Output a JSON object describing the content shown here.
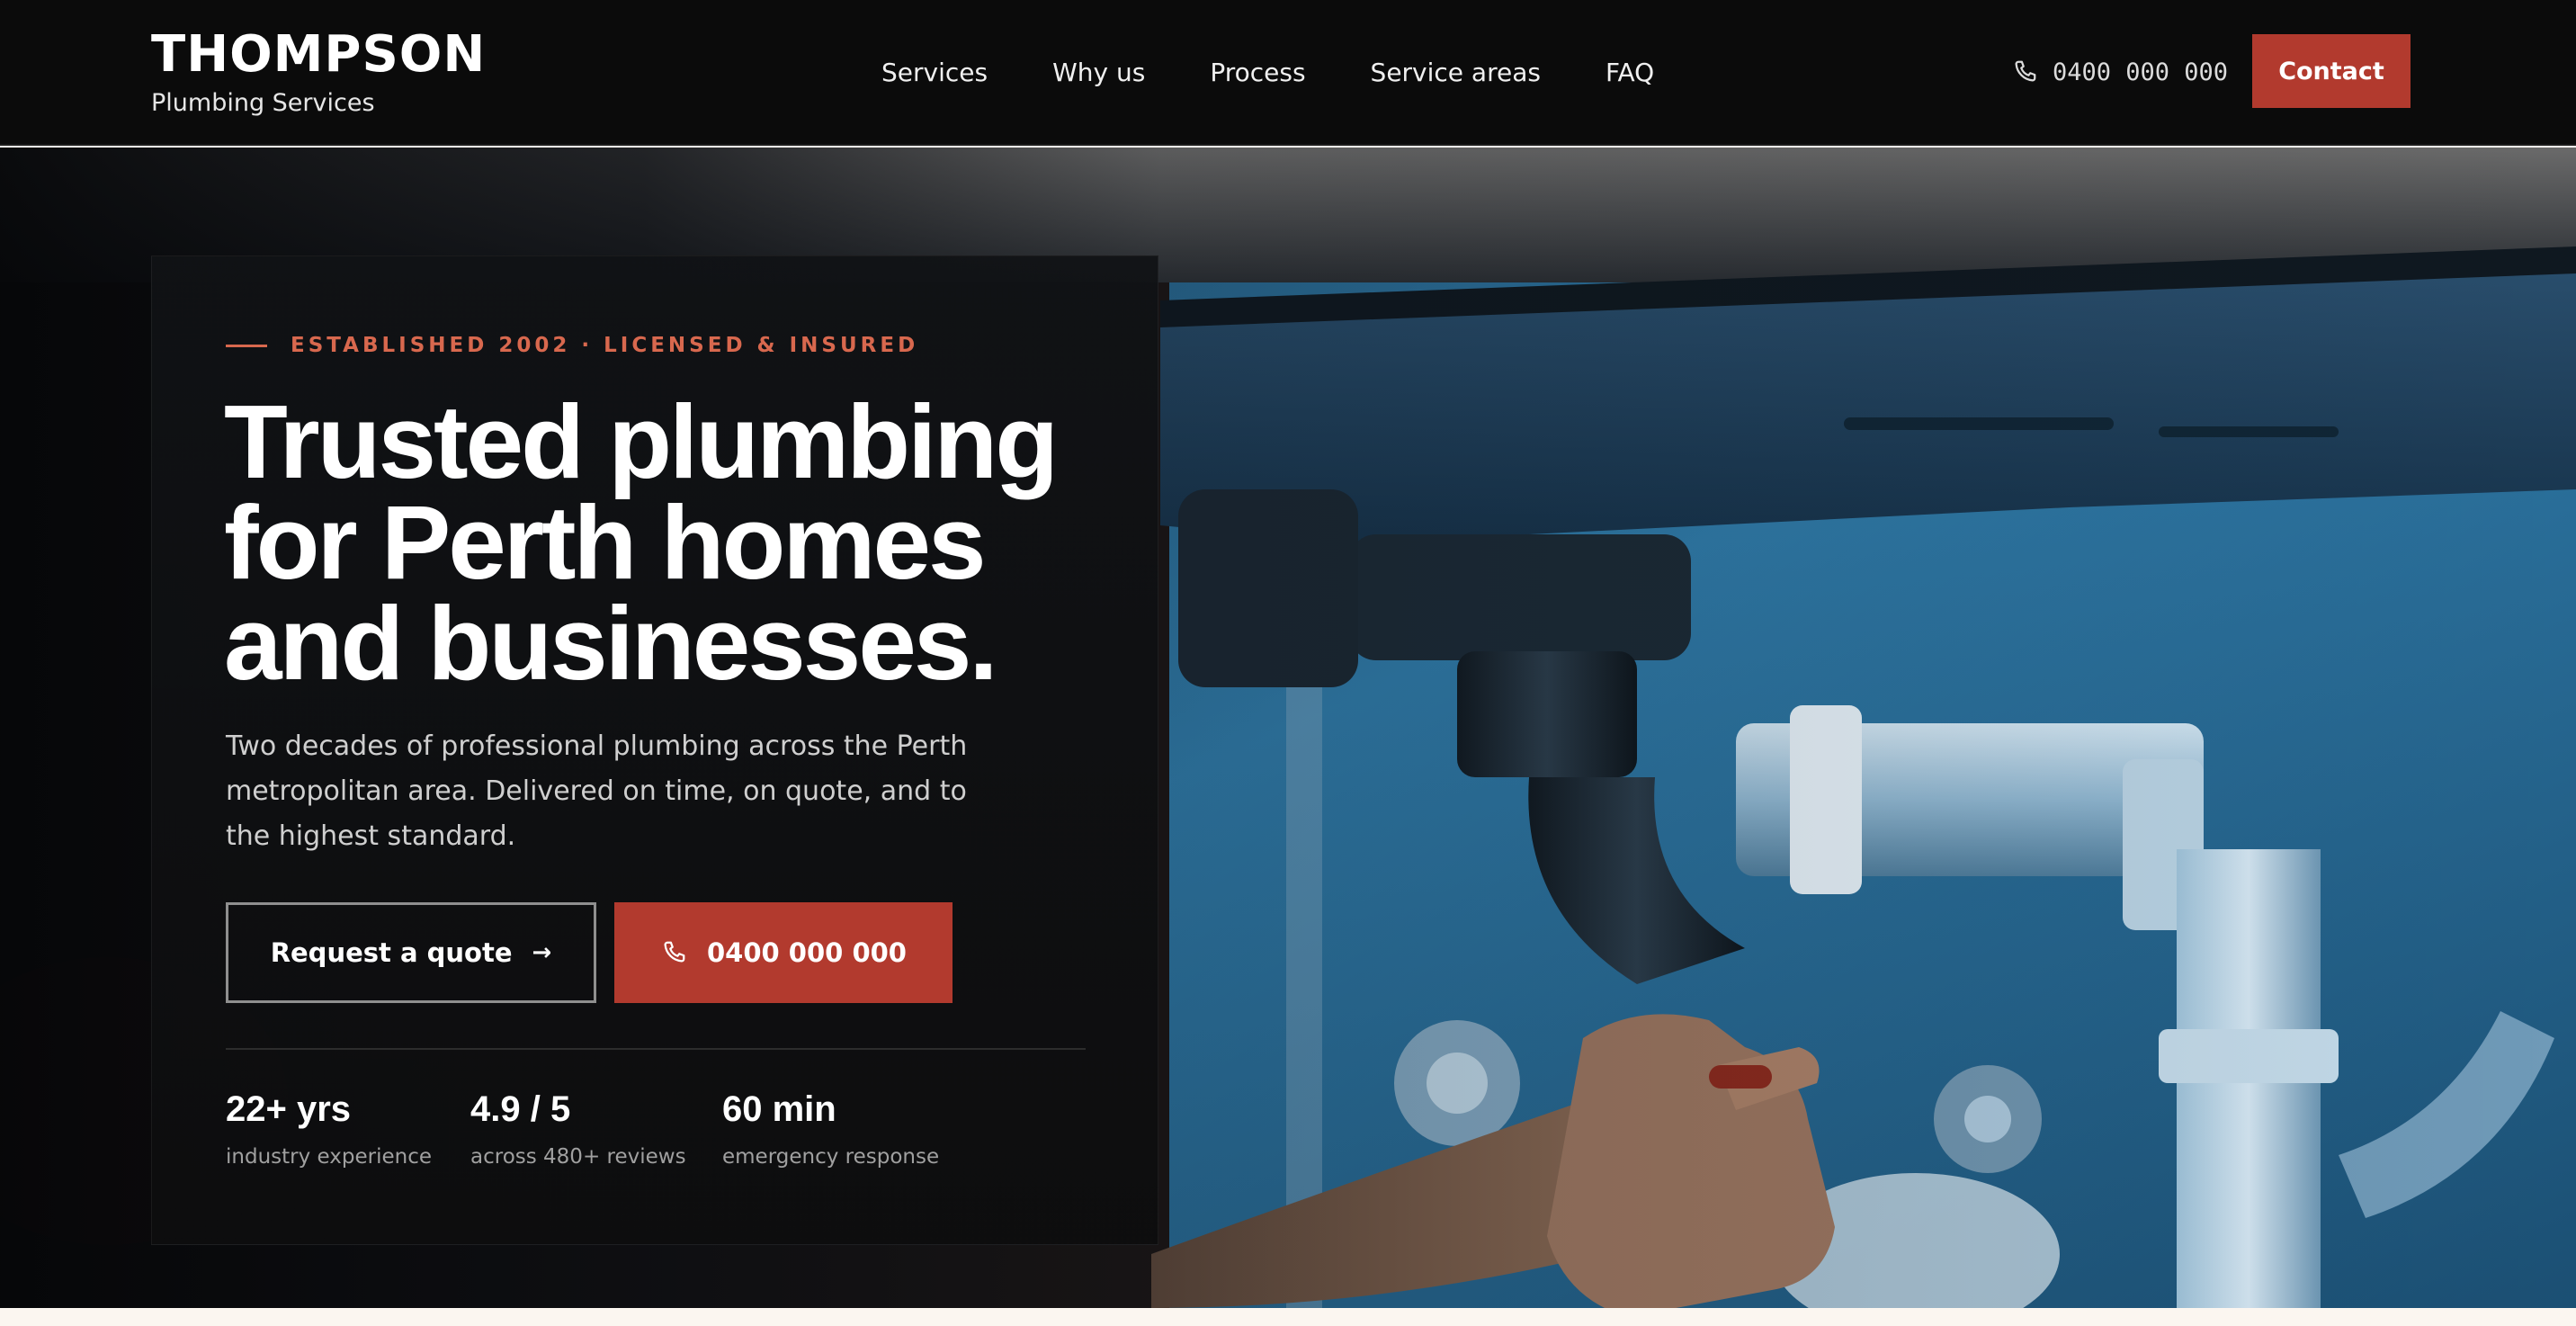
{
  "header": {
    "brand_name": "THOMPSON",
    "brand_sub": "Plumbing Services",
    "nav": [
      "Services",
      "Why us",
      "Process",
      "Service areas",
      "FAQ"
    ],
    "phone": "0400 000 000",
    "contact_label": "Contact"
  },
  "hero": {
    "eyebrow": "ESTABLISHED 2002 · LICENSED & INSURED",
    "headline_lines": [
      "Trusted plumbing",
      "for Perth homes",
      "and businesses."
    ],
    "lede": "Two decades of professional plumbing across the Perth metropolitan area. Delivered on time, on quote, and to the highest standard.",
    "quote_label": "Request a quote",
    "call_label": "0400 000 000",
    "stats": [
      {
        "value": "22+ yrs",
        "label": "industry experience"
      },
      {
        "value": "4.9 / 5",
        "label": "across 480+ reviews"
      },
      {
        "value": "60 min",
        "label": "emergency response"
      }
    ]
  },
  "icons": {
    "phone": "phone-icon",
    "arrow": "arrow-right-icon"
  },
  "colors": {
    "accent": "#b23a2e",
    "eyebrow": "#d8684e",
    "header_bg": "#0b0b0b",
    "photo_tone": "#2e6f9c"
  }
}
